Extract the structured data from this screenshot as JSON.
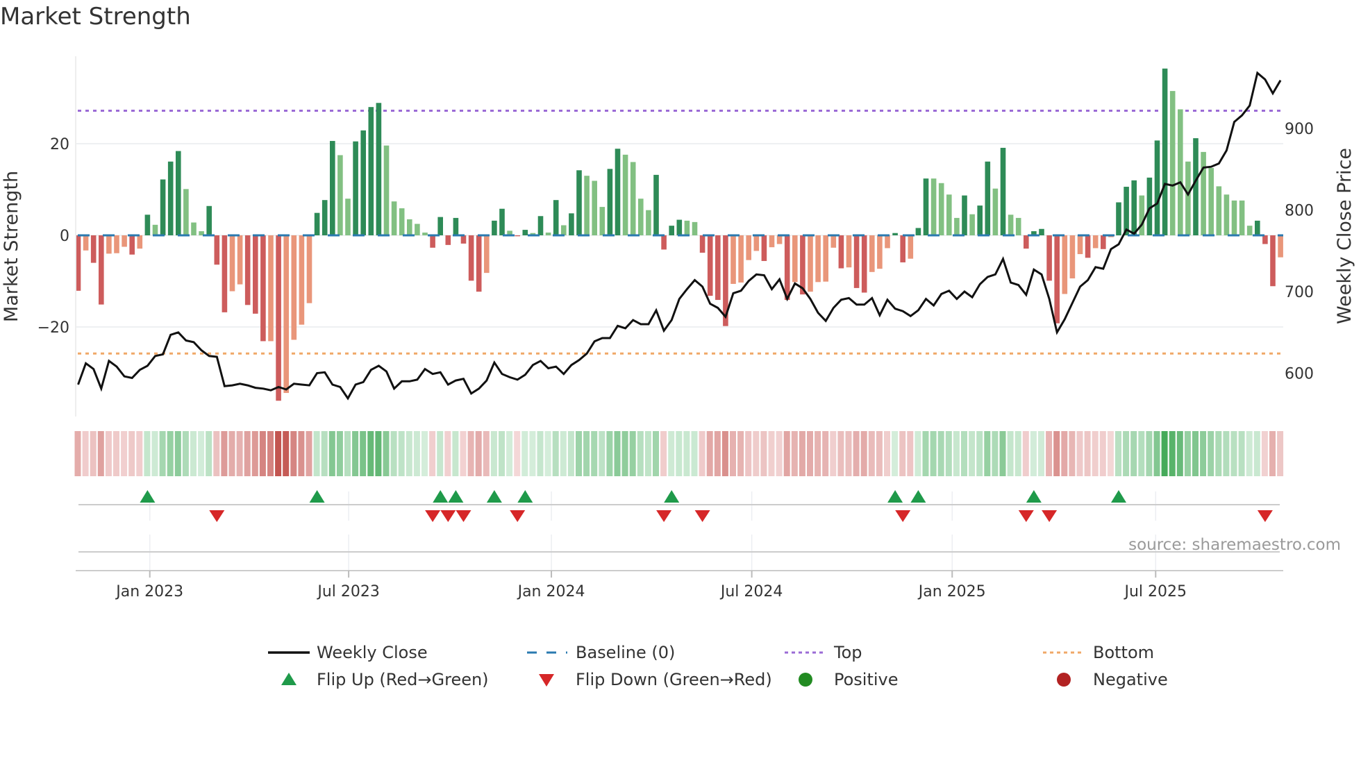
{
  "title": "Market Strength",
  "source": "source: sharemaestro.com",
  "chart_data": {
    "type": "bar",
    "title": "Market Strength",
    "ylabel": "Market Strength",
    "y2label": "Weekly Close Price",
    "ylim": [
      -38,
      39
    ],
    "y2lim": [
      555,
      995
    ],
    "yticks": [
      {
        "v": 20,
        "label": "20"
      },
      {
        "v": 0,
        "label": "0"
      },
      {
        "v": -20,
        "label": "−20"
      }
    ],
    "y2ticks": [
      {
        "v": 900,
        "label": "900"
      },
      {
        "v": 800,
        "label": "800"
      },
      {
        "v": 700,
        "label": "700"
      },
      {
        "v": 600,
        "label": "600"
      }
    ],
    "xticks": [
      {
        "week": 9.3,
        "label": "Jan 2023"
      },
      {
        "week": 35.1,
        "label": "Jul 2023"
      },
      {
        "week": 61.4,
        "label": "Jan 2024"
      },
      {
        "week": 87.4,
        "label": "Jul 2024"
      },
      {
        "week": 113.4,
        "label": "Jan 2025"
      },
      {
        "week": 139.8,
        "label": "Jul 2025"
      }
    ],
    "top_level": 27.2,
    "bottom_level": -25.8,
    "baseline": 0,
    "strength": [
      -12.1,
      -3.3,
      -6.0,
      -15.1,
      -4.0,
      -3.9,
      -2.5,
      -4.2,
      -2.9,
      4.5,
      2.3,
      12.2,
      16.1,
      18.4,
      10.1,
      2.8,
      0.9,
      6.4,
      -6.4,
      -16.8,
      -12.2,
      -10.7,
      -15.2,
      -17.1,
      -23.1,
      -23.1,
      -36.1,
      -34.4,
      -22.8,
      -19.5,
      -14.8,
      4.9,
      7.7,
      20.6,
      17.5,
      8.0,
      20.5,
      22.9,
      28.0,
      28.9,
      19.6,
      7.4,
      5.9,
      3.5,
      2.5,
      0.6,
      -2.7,
      4.0,
      -2.1,
      3.8,
      -1.8,
      -9.9,
      -12.3,
      -8.2,
      3.2,
      5.8,
      1.0,
      -0.2,
      1.2,
      0.5,
      4.2,
      0.6,
      7.7,
      2.2,
      4.8,
      14.2,
      13.0,
      11.9,
      6.2,
      14.5,
      18.9,
      17.6,
      16.0,
      8.0,
      5.5,
      13.2,
      -3.1,
      2.1,
      3.4,
      3.2,
      2.9,
      -3.8,
      -13.2,
      -14.1,
      -19.8,
      -10.6,
      -10.3,
      -5.4,
      -3.4,
      -5.6,
      -2.6,
      -1.9,
      -14.1,
      -10.2,
      -12.9,
      -12.3,
      -10.2,
      -10.1,
      -2.7,
      -7.2,
      -7.0,
      -11.5,
      -12.5,
      -8.0,
      -7.3,
      -2.8,
      0.5,
      -5.9,
      -5.1,
      1.6,
      12.4,
      12.4,
      11.4,
      8.9,
      3.8,
      8.7,
      4.6,
      6.5,
      16.1,
      10.2,
      19.1,
      4.5,
      3.8,
      -2.9,
      0.9,
      1.4,
      -9.9,
      -19.2,
      -12.8,
      -9.4,
      -4.1,
      -4.9,
      -2.8,
      -3.0,
      -0.4,
      7.2,
      10.6,
      12.0,
      8.7,
      12.6,
      20.7,
      36.4,
      31.5,
      27.5,
      16.1,
      21.2,
      18.2,
      14.7,
      10.7,
      8.9,
      7.6,
      7.6,
      2.1,
      3.2,
      -1.9,
      -11.1,
      -4.8
    ],
    "weekly_close": [
      586,
      612,
      605,
      581,
      615,
      608,
      596,
      594,
      604,
      609,
      621,
      623,
      647,
      650,
      640,
      638,
      628,
      621,
      620,
      584,
      585,
      587,
      585,
      582,
      581,
      579,
      583,
      580,
      587,
      586,
      585,
      600,
      601,
      586,
      583,
      569,
      586,
      589,
      604,
      609,
      602,
      581,
      590,
      590,
      592,
      605,
      599,
      601,
      586,
      591,
      593,
      575,
      581,
      591,
      613,
      599,
      595,
      592,
      598,
      610,
      615,
      606,
      608,
      599,
      610,
      616,
      624,
      639,
      643,
      643,
      658,
      655,
      665,
      660,
      660,
      677,
      652,
      665,
      691,
      703,
      714,
      706,
      685,
      680,
      669,
      698,
      701,
      713,
      721,
      720,
      703,
      715,
      691,
      710,
      704,
      691,
      674,
      664,
      680,
      690,
      692,
      684,
      684,
      692,
      671,
      690,
      679,
      676,
      670,
      677,
      691,
      683,
      697,
      701,
      691,
      700,
      693,
      709,
      718,
      721,
      740,
      711,
      708,
      696,
      727,
      721,
      691,
      650,
      666,
      686,
      706,
      714,
      730,
      728,
      752,
      758,
      776,
      771,
      782,
      802,
      808,
      832,
      830,
      834,
      819,
      836,
      852,
      853,
      857,
      873,
      908,
      916,
      928,
      968,
      960,
      943,
      959
    ],
    "legend": {
      "placement": "bottom",
      "items": [
        {
          "label": "Weekly Close",
          "kind": "line",
          "color": "#111111"
        },
        {
          "label": "Baseline (0)",
          "kind": "dash",
          "color": "#2a7ab0"
        },
        {
          "label": "Top",
          "kind": "dot",
          "color": "#9b6bd6"
        },
        {
          "label": "Bottom",
          "kind": "dot",
          "color": "#f0a868"
        },
        {
          "label": "Flip Up (Red→Green)",
          "kind": "up",
          "color": "#1f9a4a"
        },
        {
          "label": "Flip Down (Green→Red)",
          "kind": "down",
          "color": "#d62728"
        },
        {
          "label": "Positive",
          "kind": "circle",
          "color": "#228b22"
        },
        {
          "label": "Negative",
          "kind": "circle",
          "color": "#b22222"
        }
      ]
    },
    "colors": {
      "pos_strong": "#2e8b57",
      "pos_weak": "#82c082",
      "neg_strong": "#cd5c5c",
      "neg_weak": "#e9967a",
      "top": "#9b6bd6",
      "bottom": "#f0a868",
      "baseline": "#2a7ab0",
      "line": "#111111",
      "flip_up": "#1f9a4a",
      "flip_down": "#d62728"
    }
  }
}
